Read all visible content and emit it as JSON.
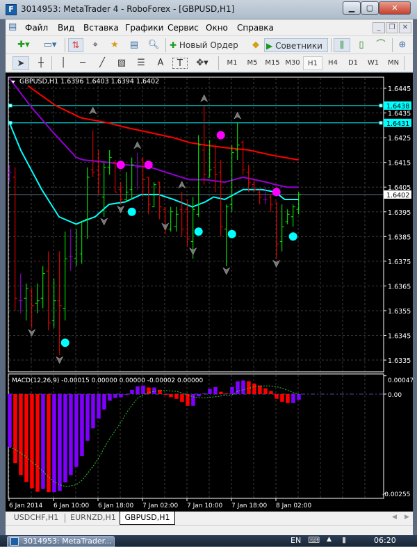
{
  "window": {
    "title": "3014953: MetaTrader 4 - RoboForex - [GBPUSD,H1]",
    "app_icon_letter": "F"
  },
  "menu": {
    "items": [
      "Файл",
      "Вид",
      "Вставка",
      "Графики",
      "Сервис",
      "Окно",
      "Справка"
    ]
  },
  "toolbar1": {
    "new_order_label": "Новый Ордер",
    "experts_label": "Советники"
  },
  "toolbar2": {
    "timeframes": [
      "M1",
      "M5",
      "M15",
      "M30",
      "H1",
      "H4",
      "D1",
      "W1",
      "MN"
    ],
    "active_timeframe": "H1",
    "text_tool": "A",
    "label_tool": "T"
  },
  "chart": {
    "header": "GBPUSD,H1  1.6396 1.6403 1.6394 1.6402",
    "price_ticks": [
      "1.6445",
      "1.6435",
      "1.6425",
      "1.6415",
      "1.6405",
      "1.6395",
      "1.6385",
      "1.6375",
      "1.6365",
      "1.6355",
      "1.6345",
      "1.6335"
    ],
    "hlines": [
      "1.6438",
      "1.6431"
    ],
    "current_price": "1.6402",
    "time_labels": [
      "6 Jan 2014",
      "6 Jan 10:00",
      "6 Jan 18:00",
      "7 Jan 02:00",
      "7 Jan 10:00",
      "7 Jan 18:00",
      "8 Jan 02:00"
    ],
    "colors": {
      "background": "#000000",
      "bull": "#00ff00",
      "bear": "#ff0000",
      "doji": "#9400d3",
      "ma_slow": "#ff0000",
      "ma_mid": "#9400d3",
      "ma_fast": "#00ffff",
      "hline": "#00ffff",
      "dot_high": "#ff00ff",
      "dot_low": "#00ffff",
      "arrow": "#808080"
    },
    "bars": [
      [
        1.6411,
        1.6414,
        1.6407,
        1.6411
      ],
      [
        1.6409,
        1.6413,
        1.6355,
        1.636
      ],
      [
        1.6359,
        1.637,
        1.6354,
        1.6359
      ],
      [
        1.636,
        1.6366,
        1.6351,
        1.6364
      ],
      [
        1.6363,
        1.6364,
        1.6348,
        1.6357
      ],
      [
        1.6358,
        1.6366,
        1.6354,
        1.6359
      ],
      [
        1.636,
        1.6373,
        1.6356,
        1.637
      ],
      [
        1.6371,
        1.6379,
        1.6347,
        1.635
      ],
      [
        1.6351,
        1.6368,
        1.6348,
        1.6359
      ],
      [
        1.6359,
        1.6379,
        1.6337,
        1.6357
      ],
      [
        1.6356,
        1.6387,
        1.6351,
        1.6376
      ],
      [
        1.6377,
        1.6388,
        1.6371,
        1.6377
      ],
      [
        1.6376,
        1.6388,
        1.6373,
        1.639
      ],
      [
        1.6378,
        1.6391,
        1.6374,
        1.6391
      ],
      [
        1.6392,
        1.6413,
        1.6384,
        1.6409
      ],
      [
        1.6412,
        1.6428,
        1.6409,
        1.6411
      ],
      [
        1.6412,
        1.642,
        1.6402,
        1.641
      ],
      [
        1.6401,
        1.6415,
        1.6393,
        1.6413
      ],
      [
        1.6413,
        1.642,
        1.641,
        1.6417
      ],
      [
        1.6415,
        1.6416,
        1.6403,
        1.6403
      ],
      [
        1.6404,
        1.6407,
        1.6398,
        1.64
      ],
      [
        1.64,
        1.6411,
        1.6399,
        1.6403
      ],
      [
        1.6404,
        1.6417,
        1.64,
        1.6414
      ],
      [
        1.6413,
        1.6419,
        1.6404,
        1.6413
      ],
      [
        1.6416,
        1.6417,
        1.6401,
        1.6408
      ],
      [
        1.6409,
        1.6409,
        1.6394,
        1.6398
      ],
      [
        1.6397,
        1.6407,
        1.6397,
        1.6406
      ],
      [
        1.6407,
        1.6407,
        1.6392,
        1.6397
      ],
      [
        1.6396,
        1.6397,
        1.6386,
        1.6388
      ],
      [
        1.6388,
        1.6397,
        1.6387,
        1.6395
      ],
      [
        1.6389,
        1.6397,
        1.6387,
        1.6394
      ],
      [
        1.6396,
        1.6403,
        1.6385,
        1.6388
      ],
      [
        1.6396,
        1.64,
        1.6381,
        1.6384
      ],
      [
        1.6383,
        1.6401,
        1.6376,
        1.6396
      ],
      [
        1.6394,
        1.6426,
        1.6393,
        1.6422
      ],
      [
        1.642,
        1.6438,
        1.6406,
        1.641
      ],
      [
        1.6409,
        1.6424,
        1.6409,
        1.6412
      ],
      [
        1.6413,
        1.6422,
        1.6403,
        1.641
      ],
      [
        1.6411,
        1.6416,
        1.6385,
        1.6389
      ],
      [
        1.6388,
        1.6398,
        1.6373,
        1.6397
      ],
      [
        1.6398,
        1.6422,
        1.6395,
        1.6419
      ],
      [
        1.642,
        1.6431,
        1.6416,
        1.6422
      ],
      [
        1.6423,
        1.6424,
        1.641,
        1.6412
      ],
      [
        1.6411,
        1.6414,
        1.6403,
        1.6407
      ],
      [
        1.6406,
        1.6408,
        1.6403,
        1.6404
      ],
      [
        1.6403,
        1.6404,
        1.6398,
        1.6401
      ],
      [
        1.64,
        1.6405,
        1.6398,
        1.64
      ],
      [
        1.6401,
        1.6402,
        1.6395,
        1.6398
      ],
      [
        1.6399,
        1.6399,
        1.6376,
        1.6382
      ],
      [
        1.6383,
        1.6398,
        1.6379,
        1.6389
      ],
      [
        1.6391,
        1.6396,
        1.639,
        1.6394
      ],
      [
        1.6393,
        1.6398,
        1.6389,
        1.6397
      ],
      [
        1.6396,
        1.6403,
        1.6394,
        1.6402
      ]
    ],
    "ma_slow": [
      [
        3.3,
        1.6446
      ],
      [
        8.3,
        1.6438
      ],
      [
        12.9,
        1.6433
      ],
      [
        17.7,
        1.6431
      ],
      [
        21.2,
        1.6429
      ],
      [
        25.4,
        1.6427
      ],
      [
        29.5,
        1.6425
      ],
      [
        32.4,
        1.6423
      ],
      [
        35.2,
        1.6422
      ],
      [
        38.7,
        1.6421
      ],
      [
        43,
        1.642
      ],
      [
        47,
        1.6418
      ],
      [
        52,
        1.6416
      ]
    ],
    "ma_mid": [
      [
        0,
        1.6449
      ],
      [
        3.7,
        1.6438
      ],
      [
        7.9,
        1.6427
      ],
      [
        12,
        1.6417
      ],
      [
        13.3,
        1.6416
      ],
      [
        17.7,
        1.6415
      ],
      [
        21.2,
        1.6414
      ],
      [
        25.4,
        1.6413
      ],
      [
        29.5,
        1.641
      ],
      [
        32.4,
        1.6408
      ],
      [
        35.2,
        1.6408
      ],
      [
        38.7,
        1.6407
      ],
      [
        42,
        1.6409
      ],
      [
        46.2,
        1.6407
      ],
      [
        47.8,
        1.6406
      ],
      [
        49.9,
        1.6405
      ],
      [
        52,
        1.6405
      ]
    ],
    "ma_fast": [
      [
        0,
        1.6431
      ],
      [
        2,
        1.642
      ],
      [
        5.8,
        1.6404
      ],
      [
        8.9,
        1.6393
      ],
      [
        12,
        1.639
      ],
      [
        13,
        1.6391
      ],
      [
        15.4,
        1.6393
      ],
      [
        17.9,
        1.6398
      ],
      [
        20.8,
        1.6399
      ],
      [
        23.7,
        1.6402
      ],
      [
        26.8,
        1.6402
      ],
      [
        29.5,
        1.64
      ],
      [
        32.9,
        1.6397
      ],
      [
        35.2,
        1.6399
      ],
      [
        36.7,
        1.6401
      ],
      [
        38.7,
        1.64
      ],
      [
        42,
        1.6404
      ],
      [
        45.4,
        1.6404
      ],
      [
        47.8,
        1.6403
      ],
      [
        49.5,
        1.64
      ],
      [
        52,
        1.64
      ]
    ],
    "dots_high": [
      [
        20,
        1.6414
      ],
      [
        25,
        1.6414
      ],
      [
        38,
        1.6426
      ],
      [
        48,
        1.6403
      ]
    ],
    "dots_low": [
      [
        10,
        1.6342
      ],
      [
        22,
        1.6395
      ],
      [
        34,
        1.6387
      ],
      [
        40,
        1.6386
      ],
      [
        51,
        1.6385
      ]
    ],
    "arrows_up": [
      [
        15,
        1.6436
      ],
      [
        23,
        1.6422
      ],
      [
        31,
        1.6406
      ],
      [
        35,
        1.6441
      ],
      [
        41,
        1.6434
      ]
    ],
    "arrows_down": [
      [
        4,
        1.6346
      ],
      [
        9,
        1.6335
      ],
      [
        17,
        1.6391
      ],
      [
        20,
        1.6396
      ],
      [
        28,
        1.6389
      ],
      [
        33,
        1.6379
      ],
      [
        39,
        1.6371
      ],
      [
        48,
        1.6374
      ]
    ]
  },
  "macd": {
    "label": "MACD(12,26,9) -0.00015 0.00000 0.00000 -0.00002 0.00000",
    "ticks": [
      "0.00047",
      "0.00",
      "-0.00255"
    ],
    "histogram": [
      -0.00136,
      -0.00177,
      -0.00208,
      -0.00226,
      -0.00242,
      -0.00251,
      -0.00244,
      -0.00252,
      -0.00252,
      -0.00249,
      -0.00227,
      -0.00208,
      -0.00187,
      -0.00159,
      -0.0012,
      -0.00088,
      -0.00063,
      -0.0004,
      -0.00017,
      -0.0001,
      -8e-05,
      -2e-05,
      0.00011,
      0.0002,
      0.00022,
      0.00017,
      0.00017,
      0.00011,
      -2e-05,
      -8e-05,
      -0.00012,
      -0.0002,
      -0.0003,
      -0.0003,
      -6e-05,
      2e-05,
      0.00013,
      0.00018,
      6e-05,
      2e-05,
      0.00018,
      0.00033,
      0.00035,
      0.00033,
      0.00027,
      0.00022,
      0.00015,
      8e-05,
      -0.00012,
      -0.0002,
      -0.00023,
      -0.00023,
      -0.00015
    ],
    "hist_colors": "PRRRRRPRPPPPPPPPPPPPPPPPPRPRRRRRRPPPPPRRPPPRRRRRRRRPP",
    "color_map": {
      "P": "#8000ff",
      "R": "#ff0000"
    },
    "signal": [
      -0.00136,
      -0.00142,
      -0.00151,
      -0.00162,
      -0.00174,
      -0.00186,
      -0.00198,
      -0.00213,
      -0.00225,
      -0.00233,
      -0.00237,
      -0.00236,
      -0.00233,
      -0.00222,
      -0.00204,
      -0.00186,
      -0.00165,
      -0.00139,
      -0.00115,
      -0.00094,
      -0.00073,
      -0.00049,
      -0.00029,
      -0.00011,
      -2e-05,
      4e-05,
      7e-05,
      9e-05,
      9e-05,
      8e-05,
      7e-05,
      3e-05,
      -2e-05,
      -7e-05,
      -9e-05,
      -0.0001,
      -8e-05,
      -7e-05,
      -5e-05,
      -4e-05,
      -2e-05,
      7e-05,
      0.00011,
      0.00015,
      0.00019,
      0.00021,
      0.00021,
      0.00021,
      0.00019,
      0.00015,
      0.0001,
      4e-05,
      0.0
    ],
    "signal_color": "#32cd32",
    "ylim": [
      -0.00255,
      0.00047
    ]
  },
  "tabs": {
    "items": [
      "USDCHF,H1",
      "EURNZD,H1",
      "GBPUSD,H1"
    ],
    "active": 2
  },
  "taskbar": {
    "task_label": "3014953: MetaTrader...",
    "language": "EN",
    "clock": "06:20"
  }
}
